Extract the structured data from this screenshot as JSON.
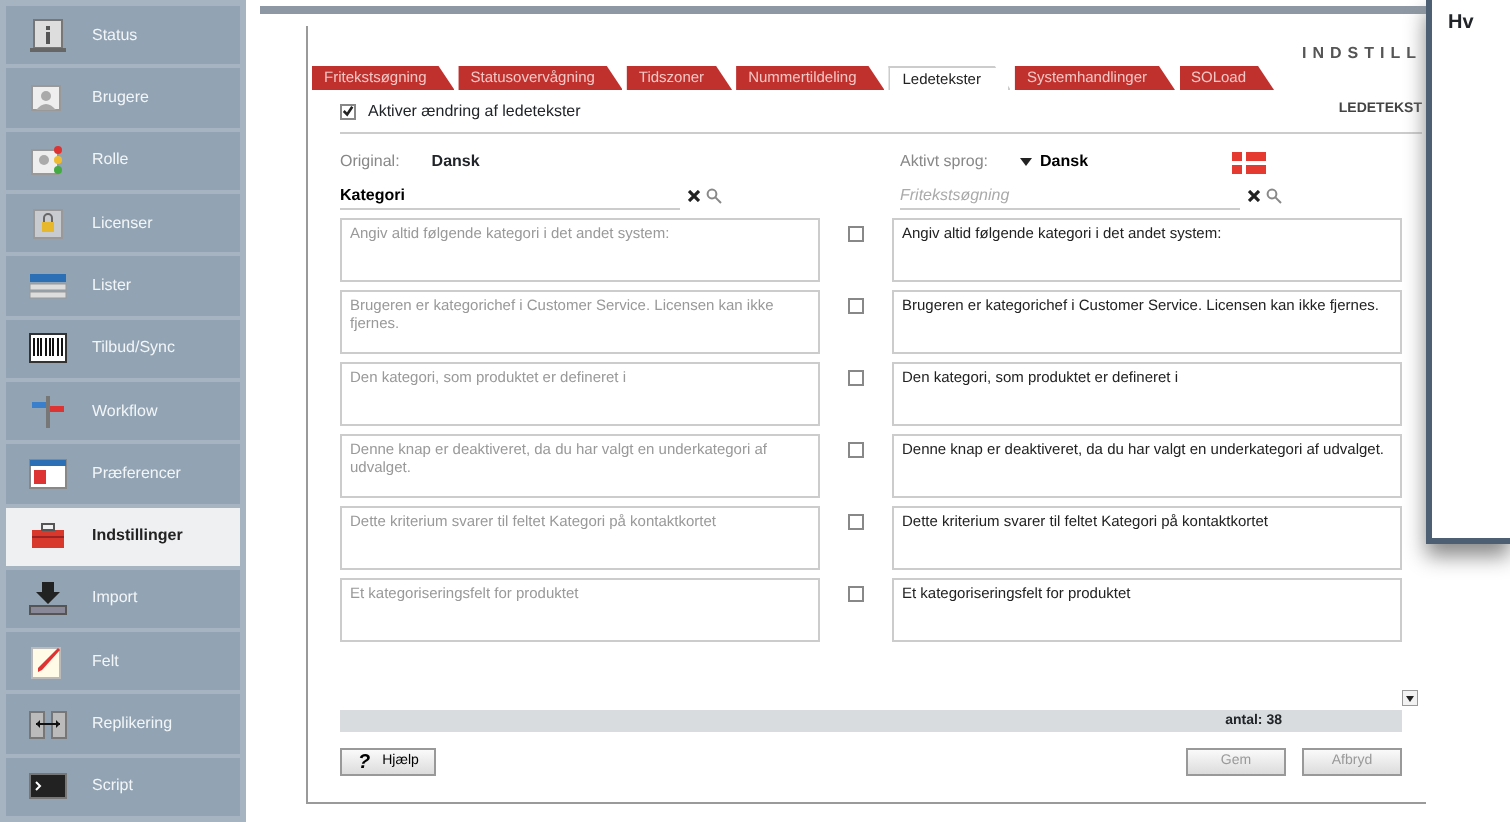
{
  "sidebar": {
    "items": [
      {
        "label": "Status",
        "selected": false
      },
      {
        "label": "Brugere",
        "selected": false
      },
      {
        "label": "Rolle",
        "selected": false
      },
      {
        "label": "Licenser",
        "selected": false
      },
      {
        "label": "Lister",
        "selected": false
      },
      {
        "label": "Tilbud/Sync",
        "selected": false
      },
      {
        "label": "Workflow",
        "selected": false
      },
      {
        "label": "Præferencer",
        "selected": false
      },
      {
        "label": "Indstillinger",
        "selected": true
      },
      {
        "label": "Import",
        "selected": false
      },
      {
        "label": "Felt",
        "selected": false
      },
      {
        "label": "Replikering",
        "selected": false
      },
      {
        "label": "Script",
        "selected": false
      }
    ]
  },
  "header": {
    "title": "INDSTILL"
  },
  "tabs": [
    {
      "label": "Fritekstsøgning",
      "selected": false
    },
    {
      "label": "Statusovervågning",
      "selected": false
    },
    {
      "label": "Tidszoner",
      "selected": false
    },
    {
      "label": "Nummertildeling",
      "selected": false
    },
    {
      "label": "Ledetekster",
      "selected": true
    },
    {
      "label": "Systemhandlinger",
      "selected": false
    },
    {
      "label": "SOLoad",
      "selected": false
    }
  ],
  "enable_checkbox": {
    "label": "Aktiver ændring af ledetekster",
    "checked": true
  },
  "section_title": "LEDETEKST",
  "original": {
    "label": "Original:",
    "language": "Dansk",
    "search_value": "Kategori"
  },
  "active": {
    "label": "Aktivt sprog:",
    "language": "Dansk",
    "search_placeholder": "Fritekstsøgning"
  },
  "rows": [
    {
      "original": "Angiv altid følgende kategori i det andet system:",
      "checked": false,
      "translation": "Angiv altid følgende kategori i det andet system:"
    },
    {
      "original": "Brugeren er kategorichef i Customer Service. Licensen kan ikke fjernes.",
      "checked": false,
      "translation": "Brugeren er kategorichef i Customer Service. Licensen kan ikke fjernes."
    },
    {
      "original": "Den kategori, som produktet er defineret i",
      "checked": false,
      "translation": "Den kategori, som produktet er defineret i"
    },
    {
      "original": "Denne knap er deaktiveret, da du har valgt en underkategori af udvalget.",
      "checked": false,
      "translation": "Denne knap er deaktiveret, da du har valgt en underkategori af udvalget."
    },
    {
      "original": "Dette kriterium svarer til feltet Kategori på kontaktkortet",
      "checked": false,
      "translation": "Dette kriterium svarer til feltet Kategori på kontaktkortet"
    },
    {
      "original": "Et kategoriseringsfelt for produktet",
      "checked": false,
      "translation": "Et kategoriseringsfelt for produktet"
    }
  ],
  "count": "antal: 38",
  "buttons": [
    {
      "label": "Hjælp",
      "kind": "help",
      "icon": "?",
      "disabled": false
    },
    {
      "label": "Gem",
      "kind": "plain",
      "disabled": true
    },
    {
      "label": "Afbryd",
      "kind": "plain",
      "disabled": true
    }
  ],
  "side_window": {
    "text": "Hv"
  }
}
